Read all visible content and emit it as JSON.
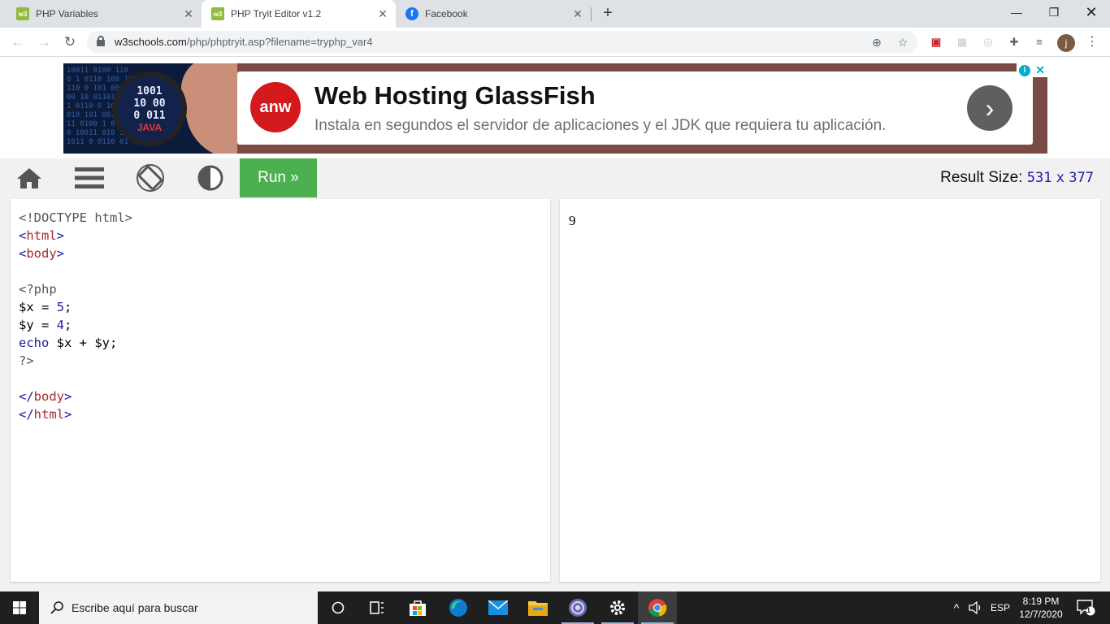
{
  "browser": {
    "tabs": [
      {
        "title": "PHP Variables",
        "favicon": "w3"
      },
      {
        "title": "PHP Tryit Editor v1.2",
        "favicon": "w3",
        "active": true
      },
      {
        "title": "Facebook",
        "favicon": "f"
      }
    ],
    "url_host": "w3schools.com",
    "url_path": "/php/phptryit.asp?filename=tryphp_var4",
    "avatar_letter": "j"
  },
  "ad": {
    "title": "Web Hosting GlassFish",
    "subtitle": "Instala en segundos el servidor de aplicaciones y el JDK que requiera tu aplicación.",
    "brand": "anw",
    "image_text": "JAVA",
    "arrow": "›"
  },
  "editor_toolbar": {
    "run_label": "Run »",
    "result_size_label": "Result Size:",
    "result_width": "531",
    "result_x": "x",
    "result_height": "377"
  },
  "code": {
    "lines": [
      "<!DOCTYPE html>",
      "<html>",
      "<body>",
      "",
      "<?php",
      "$x = 5;",
      "$y = 4;",
      "echo $x + $y;",
      "?>",
      "",
      "</body>",
      "</html>"
    ]
  },
  "result": {
    "output": "9"
  },
  "taskbar": {
    "search_placeholder": "Escribe aquí para buscar",
    "language": "ESP",
    "time": "8:19 PM",
    "date": "12/7/2020",
    "notification_count": "1"
  },
  "colors": {
    "run_green": "#4caf50",
    "ad_background": "#7a4a44",
    "anw_red": "#d3191b",
    "taskbar": "#1f1f1f"
  }
}
